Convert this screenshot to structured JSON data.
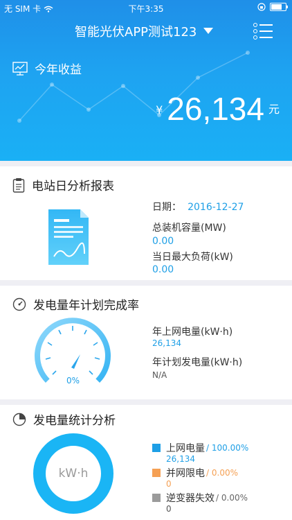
{
  "status_bar": {
    "carrier": "无 SIM 卡",
    "time": "下午3:35"
  },
  "header": {
    "title": "智能光伏APP测试123"
  },
  "income": {
    "label": "今年收益",
    "currency": "¥",
    "value": "26,134",
    "unit": "元"
  },
  "report": {
    "title": "电站日分析报表",
    "date_label": "日期：",
    "date_value": "2016-12-27",
    "capacity_label": "总装机容量(MW)",
    "capacity_value": "0.00",
    "load_label": "当日最大负荷(kW)",
    "load_value": "0.00"
  },
  "plan": {
    "title": "发电量年计划完成率",
    "gauge_percent": "0%",
    "gauge_fraction": 0.0,
    "grid_label": "年上网电量(kW·h)",
    "grid_value": "26,134",
    "planned_label": "年计划发电量(kW·h)",
    "planned_value": "N/A"
  },
  "stats": {
    "title": "发电量统计分析",
    "donut_unit": "kW·h",
    "items": [
      {
        "name": "上网电量",
        "sep": "/",
        "percent": "100.00%",
        "value": "26,134",
        "color": "#1e9fe6"
      },
      {
        "name": "并网限电",
        "sep": "/",
        "percent": "0.00%",
        "value": "0",
        "color": "#f5a054"
      },
      {
        "name": "逆变器失效",
        "sep": "/",
        "percent": "0.00%",
        "value": "0",
        "color": "#9b9b9b"
      }
    ]
  },
  "colors": {
    "accent": "#1e9fe6",
    "header_bg": "#1f8fe8",
    "separator": "#efeff4"
  }
}
